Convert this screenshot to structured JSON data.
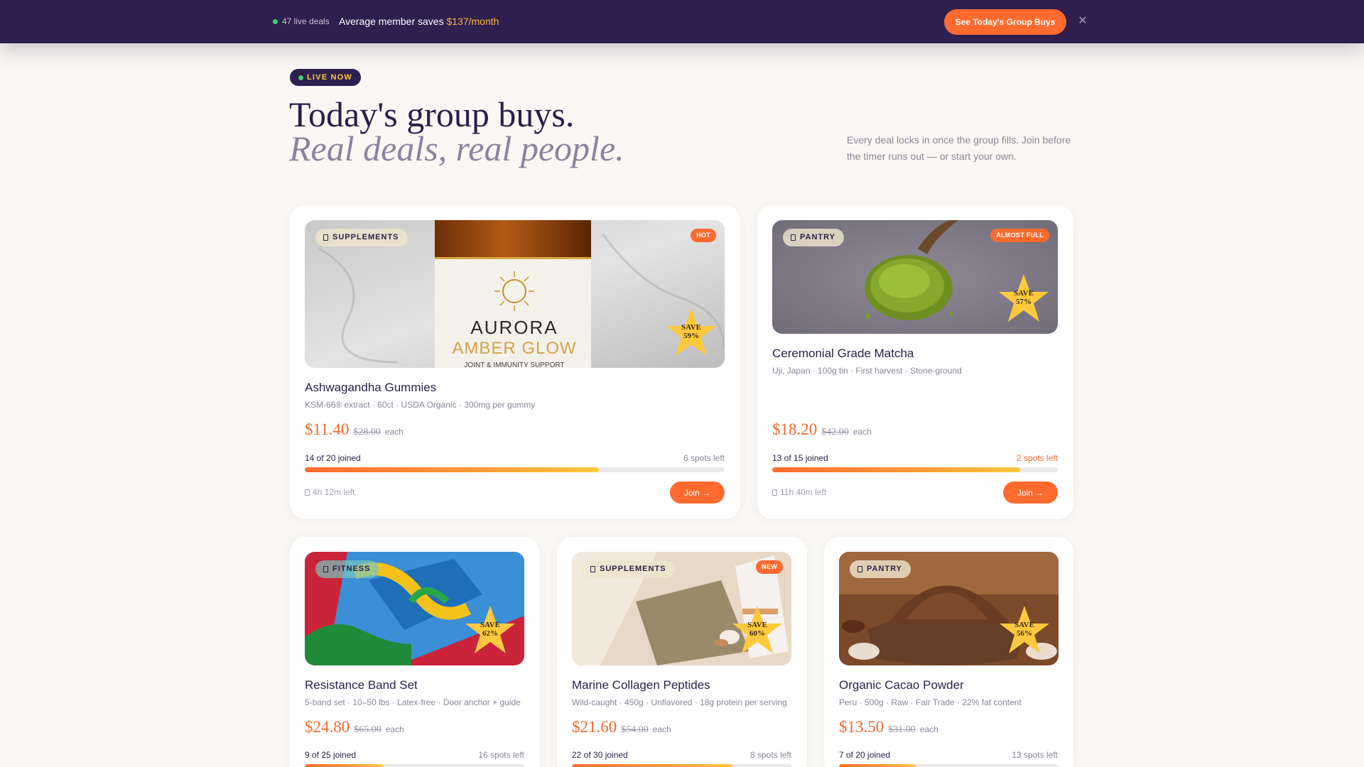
{
  "banner": {
    "live_count": "47 live deals",
    "saves_prefix": "Average member saves ",
    "saves_amount": "$137/month",
    "cta_label": "See Today's Group Buys",
    "close_glyph": "✕"
  },
  "hero": {
    "live_label": "LIVE NOW",
    "title": "Today's group buys.",
    "subtitle": "Real deals, real people.",
    "description": "Every deal locks in once the group fills. Join before the timer runs out — or start your own."
  },
  "colors": {
    "banner_bg": "#2d1f4e",
    "accent_orange": "#ff6a2f",
    "accent_yellow": "#ffc93f",
    "live_green": "#3ecf6e",
    "page_bg": "#faf8f4"
  },
  "deals": [
    {
      "category": "SUPPLEMENTS",
      "badge": "HOT",
      "save_word": "SAVE",
      "save_pct": "59%",
      "name": "Ashwagandha Gummies",
      "specs": "KSM-66® extract · 60ct · USDA Organic · 300mg per gummy",
      "price": "$11.40",
      "old_price": "$28.00",
      "unit": "each",
      "joined": "14 of 20 joined",
      "spots": "6 spots left",
      "progress": 0.7,
      "timer": "4h 12m left",
      "join_label": "Join →",
      "image_text": {
        "brand": "AURORA",
        "line2": "AMBER GLOW",
        "line3": "JOINT & IMMUNITY SUPPORT"
      }
    },
    {
      "category": "PANTRY",
      "badge": "ALMOST FULL",
      "save_word": "SAVE",
      "save_pct": "57%",
      "name": "Ceremonial Grade Matcha",
      "specs": "Uji, Japan · 100g tin · First harvest · Stone-ground",
      "price": "$18.20",
      "old_price": "$42.00",
      "unit": "each",
      "joined": "13 of 15 joined",
      "spots": "2 spots left",
      "progress": 0.867,
      "timer": "11h 40m left",
      "join_label": "Join →"
    },
    {
      "category": "FITNESS",
      "save_word": "SAVE",
      "save_pct": "62%",
      "name": "Resistance Band Set",
      "specs": "5-band set · 10–50 lbs · Latex-free · Door anchor + guide",
      "price": "$24.80",
      "old_price": "$65.00",
      "unit": "each",
      "joined": "9 of 25 joined",
      "spots": "16 spots left",
      "progress": 0.36
    },
    {
      "category": "SUPPLEMENTS",
      "badge": "NEW",
      "save_word": "SAVE",
      "save_pct": "60%",
      "name": "Marine Collagen Peptides",
      "specs": "Wild-caught · 450g · Unflavored · 18g protein per serving",
      "price": "$21.60",
      "old_price": "$54.00",
      "unit": "each",
      "joined": "22 of 30 joined",
      "spots": "8 spots left",
      "progress": 0.733
    },
    {
      "category": "PANTRY",
      "save_word": "SAVE",
      "save_pct": "56%",
      "name": "Organic Cacao Powder",
      "specs": "Peru · 500g · Raw · Fair Trade · 22% fat content",
      "price": "$13.50",
      "old_price": "$31.00",
      "unit": "each",
      "joined": "7 of 20 joined",
      "spots": "13 spots left",
      "progress": 0.35
    }
  ]
}
